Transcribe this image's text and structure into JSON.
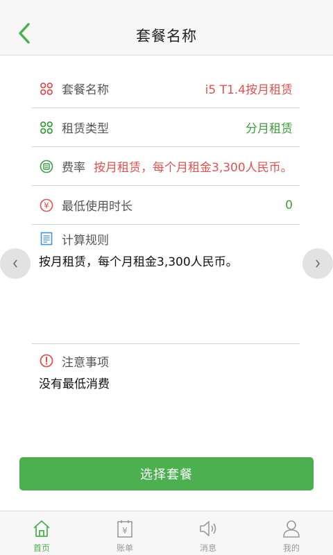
{
  "header": {
    "title": "套餐名称"
  },
  "rows": [
    {
      "label": "套餐名称",
      "value": "i5 T1.4按月租赁",
      "icon": "clover-icon"
    },
    {
      "label": "租赁类型",
      "value": "分月租赁",
      "icon": "clover-icon"
    },
    {
      "label": "费率",
      "value": "按月租赁，每个月租金3,300人民币。",
      "icon": "rate-icon"
    },
    {
      "label": "最低使用时长",
      "value": "0",
      "icon": "yuan-icon"
    }
  ],
  "rules": {
    "label": "计算规则",
    "text": "按月租赁，每个月租金3,300人民币。"
  },
  "notice": {
    "label": "注意事项",
    "text": "没有最低消费"
  },
  "action": {
    "select_label": "选择套餐"
  },
  "tabs": [
    {
      "label": "首页",
      "icon": "home-icon",
      "active": true
    },
    {
      "label": "账单",
      "icon": "bill-icon",
      "active": false
    },
    {
      "label": "消息",
      "icon": "speaker-icon",
      "active": false
    },
    {
      "label": "我的",
      "icon": "user-icon",
      "active": false
    }
  ],
  "colors": {
    "accent": "#4caf50",
    "value_red": "#e05252",
    "value_green": "#3d9e3d"
  }
}
